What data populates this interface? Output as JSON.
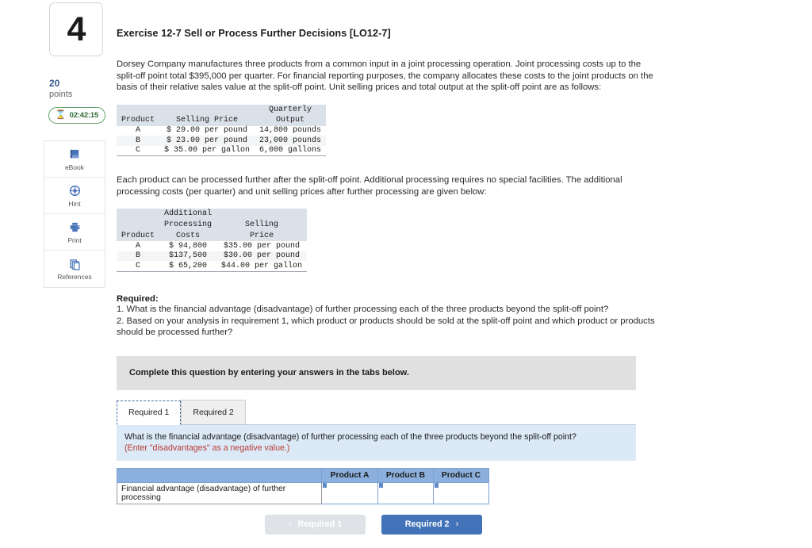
{
  "question": {
    "number": "4",
    "points_value": "20",
    "points_label": "points",
    "timer": "02:42:15",
    "timer_icon": "hourglass-icon"
  },
  "tools": [
    {
      "label": "eBook",
      "icon": "ebook-icon"
    },
    {
      "label": "Hint",
      "icon": "hint-icon"
    },
    {
      "label": "Print",
      "icon": "print-icon"
    },
    {
      "label": "References",
      "icon": "references-icon"
    }
  ],
  "exercise": {
    "title": "Exercise 12-7 Sell or Process Further Decisions [LO12-7]",
    "intro": "Dorsey Company manufactures three products from a common input in a joint processing operation. Joint processing costs up to the split-off point total $395,000 per quarter. For financial reporting purposes, the company allocates these costs to the joint products on the basis of their relative sales value at the split-off point. Unit selling prices and total output at the split-off point are as follows:",
    "second_para": "Each product can be processed further after the split-off point. Additional processing requires no special facilities. The additional processing costs (per quarter) and unit selling prices after further processing are given below:"
  },
  "table1": {
    "headers": [
      "Product",
      "Selling Price",
      "Quarterly Output"
    ],
    "header_line1": [
      "",
      "",
      "Quarterly"
    ],
    "header_line2": [
      "Product",
      "Selling Price",
      "Output"
    ],
    "rows": [
      {
        "product": "A",
        "price": "$ 29.00 per pound",
        "output": "14,800 pounds"
      },
      {
        "product": "B",
        "price": "$ 23.00 per pound",
        "output": "23,000 pounds"
      },
      {
        "product": "C",
        "price": "$ 35.00 per gallon",
        "output": "6,000 gallons"
      }
    ]
  },
  "table2": {
    "header_line1": [
      "",
      "Additional",
      ""
    ],
    "header_line2": [
      "",
      "Processing",
      "Selling"
    ],
    "header_line3": [
      "Product",
      "Costs",
      "Price"
    ],
    "rows": [
      {
        "product": "A",
        "cost": "$ 94,800",
        "price": "$35.00 per pound"
      },
      {
        "product": "B",
        "cost": "$137,500",
        "price": "$30.00 per pound"
      },
      {
        "product": "C",
        "cost": "$ 65,200",
        "price": "$44.00 per gallon"
      }
    ]
  },
  "required": {
    "heading": "Required:",
    "item1": "1. What is the financial advantage (disadvantage) of further processing each of the three products beyond the split-off point?",
    "item2": "2. Based on your analysis in requirement 1, which product or products should be sold at the split-off point and which product or products should be processed further?"
  },
  "widget": {
    "complete_bar": "Complete this question by entering your answers in the tabs below.",
    "tabs": [
      {
        "label": "Required 1",
        "active": true
      },
      {
        "label": "Required 2",
        "active": false
      }
    ],
    "question_text": "What is the financial advantage (disadvantage) of further processing each of the three products beyond the split-off point?",
    "note_text": "(Enter \"disadvantages\" as a negative value.)",
    "answer_table": {
      "row_label": "Financial advantage (disadvantage) of further processing",
      "columns": [
        "Product A",
        "Product B",
        "Product C"
      ],
      "values": [
        "",
        "",
        ""
      ]
    },
    "nav": {
      "prev_label": "Required 1",
      "prev_chevron": "‹",
      "next_label": "Required 2",
      "next_chevron": "›"
    }
  },
  "colors": {
    "accent_blue": "#4273b8",
    "header_blue": "#8cb0dd",
    "panel_blue": "#dce9f7",
    "note_red": "#b93c34",
    "timer_green": "#62a164"
  }
}
